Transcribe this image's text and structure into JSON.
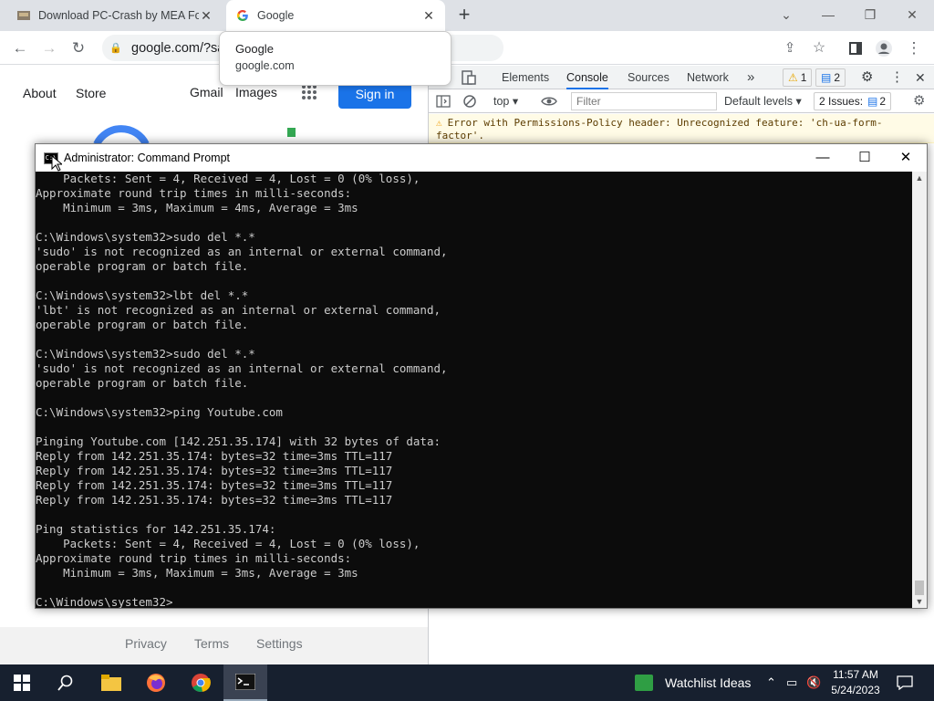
{
  "browser": {
    "tabs": [
      {
        "title": "Download PC-Crash by MEA Forensic",
        "favicon": "pc-crash-favicon"
      },
      {
        "title": "Google",
        "favicon": "google-favicon"
      }
    ],
    "new_tab_symbol": "+",
    "url": "google.com/?sa",
    "tooltip": {
      "title": "Google",
      "url": "google.com"
    }
  },
  "google_page": {
    "left_links": [
      "About",
      "Store"
    ],
    "right_links": [
      "Gmail",
      "Images"
    ],
    "sign_in": "Sign in",
    "footer_links": [
      "Privacy",
      "Terms",
      "Settings"
    ]
  },
  "devtools": {
    "tabs": [
      "Elements",
      "Console",
      "Sources",
      "Network"
    ],
    "more": "»",
    "warnings_count": "1",
    "messages_count": "2",
    "context": "top",
    "filter_placeholder": "Filter",
    "levels": "Default levels",
    "issues_label": "2 Issues:",
    "issues_count": "2",
    "error_text": "Error with Permissions-Policy header: Unrecognized feature: 'ch-ua-form-factor'."
  },
  "cmd": {
    "title": "Administrator: Command Prompt",
    "output": "    Packets: Sent = 4, Received = 4, Lost = 0 (0% loss),\nApproximate round trip times in milli-seconds:\n    Minimum = 3ms, Maximum = 4ms, Average = 3ms\n\nC:\\Windows\\system32>sudo del *.*\n'sudo' is not recognized as an internal or external command,\noperable program or batch file.\n\nC:\\Windows\\system32>lbt del *.*\n'lbt' is not recognized as an internal or external command,\noperable program or batch file.\n\nC:\\Windows\\system32>sudo del *.*\n'sudo' is not recognized as an internal or external command,\noperable program or batch file.\n\nC:\\Windows\\system32>ping Youtube.com\n\nPinging Youtube.com [142.251.35.174] with 32 bytes of data:\nReply from 142.251.35.174: bytes=32 time=3ms TTL=117\nReply from 142.251.35.174: bytes=32 time=3ms TTL=117\nReply from 142.251.35.174: bytes=32 time=3ms TTL=117\nReply from 142.251.35.174: bytes=32 time=3ms TTL=117\n\nPing statistics for 142.251.35.174:\n    Packets: Sent = 4, Received = 4, Lost = 0 (0% loss),\nApproximate round trip times in milli-seconds:\n    Minimum = 3ms, Maximum = 3ms, Average = 3ms\n\nC:\\Windows\\system32>"
  },
  "taskbar": {
    "watchlist": "Watchlist Ideas",
    "time": "11:57 AM",
    "date": "5/24/2023"
  },
  "colors": {
    "chrome_tabstrip": "#dee1e6",
    "google_blue": "#1a73e8",
    "taskbar": "#17202f",
    "console_bg": "#0c0c0c"
  }
}
